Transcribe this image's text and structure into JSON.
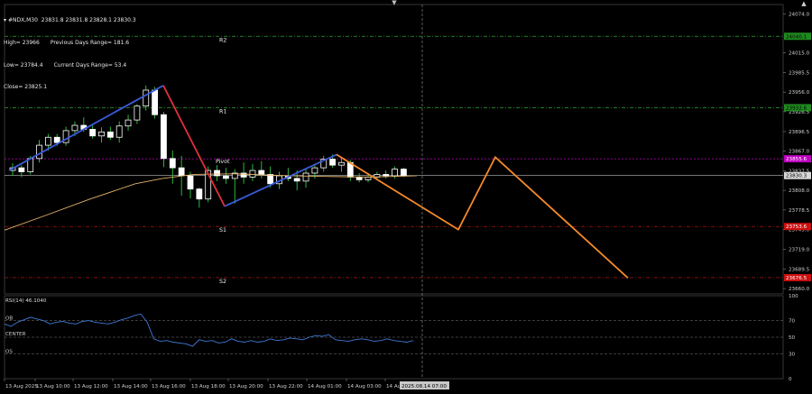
{
  "header": {
    "symbol": "#NDX,M30",
    "ohlc": "23831.8 23831.8 23828.1 23830.3",
    "high": "High= 23966",
    "low": "Low= 23784.4",
    "close": "Close= 23825.1",
    "prev_range": "Previous Days Range= 181.6",
    "curr_range": "Current Days Range= 53.4",
    "collapse_icon": "triangle-down-icon"
  },
  "pivot_labels": {
    "r2": "R2",
    "r1": "R1",
    "pivot": "Pivot",
    "s1": "S1",
    "s2": "S2"
  },
  "price_axis": {
    "ticks": [
      "24074.0",
      "24015.0",
      "23985.5",
      "23956.0",
      "23926.5",
      "23896.5",
      "23867.0",
      "23837.5",
      "23808.0",
      "23778.5",
      "23749.0",
      "23719.0",
      "23689.5",
      "23660.0"
    ],
    "level_tags": [
      {
        "text": "24040.1",
        "color": "#1f8a1f",
        "fg": "#000000"
      },
      {
        "text": "23932.6",
        "color": "#1f8a1f",
        "fg": "#000000"
      },
      {
        "text": "23855.6",
        "color": "#c000c0",
        "fg": "#ffffff"
      },
      {
        "text": "23830.3",
        "color": "#d8d8d8",
        "fg": "#000000"
      },
      {
        "text": "23753.6",
        "color": "#cc1010",
        "fg": "#ffffff"
      },
      {
        "text": "23676.5",
        "color": "#cc1010",
        "fg": "#ffffff"
      }
    ]
  },
  "rsi": {
    "label": "RSI(14) 46.1040",
    "ob": "OB",
    "center": "CENTER",
    "os": "OS",
    "ticks": [
      "100",
      "70",
      "50",
      "30",
      "0"
    ],
    "values": [
      66,
      63,
      68,
      71,
      74,
      72,
      70,
      66,
      68,
      69,
      67,
      66,
      69,
      70,
      68,
      67,
      66,
      68,
      71,
      73,
      76,
      78,
      68,
      48,
      45,
      46,
      44,
      43,
      42,
      39,
      47,
      45,
      46,
      43,
      44,
      48,
      45,
      44,
      46,
      44,
      45,
      48,
      46,
      47,
      49,
      48,
      47,
      50,
      52,
      51,
      53,
      47,
      46,
      45,
      47,
      48,
      47,
      45,
      46,
      48,
      46,
      45,
      44,
      46
    ]
  },
  "time_axis": {
    "labels": [
      "13 Aug 2025",
      "13 Aug 10:00",
      "13 Aug 12:00",
      "13 Aug 14:00",
      "13 Aug 16:00",
      "13 Aug 18:00",
      "13 Aug 20:00",
      "13 Aug 22:00",
      "14 Aug 01:00",
      "14 Aug 03:00",
      "14 Au"
    ],
    "cursor_label": "2025.08.14 07:00"
  },
  "colors": {
    "background": "#000000",
    "bull": "#ffffff",
    "bear": "#ffffff",
    "wick": "#2ecc40",
    "ma": "#e3b36a",
    "zigzag_up": "#3a5bd9",
    "zigzag_down": "#e0303a",
    "projection": "#f58a2a",
    "resistance": "#2ea62e",
    "support": "#cc1a1a",
    "pivot": "#c000c0",
    "rsi_line": "#3f79d6",
    "axis_text": "#cfcfcf"
  },
  "chart_data": {
    "type": "candlestick",
    "symbol": "#NDX",
    "timeframe": "M30",
    "levels": {
      "R2": 24040.1,
      "R1": 23932.6,
      "Pivot": 23855.6,
      "S1": 23753.6,
      "S2": 23676.5,
      "current": 23830.3
    },
    "candles": [
      [
        23838,
        23849,
        23830,
        23842
      ],
      [
        23842,
        23846,
        23828,
        23836
      ],
      [
        23836,
        23860,
        23832,
        23856
      ],
      [
        23856,
        23884,
        23850,
        23876
      ],
      [
        23876,
        23893,
        23868,
        23888
      ],
      [
        23888,
        23893,
        23875,
        23880
      ],
      [
        23880,
        23904,
        23875,
        23898
      ],
      [
        23898,
        23912,
        23890,
        23906
      ],
      [
        23906,
        23918,
        23896,
        23900
      ],
      [
        23900,
        23906,
        23886,
        23890
      ],
      [
        23890,
        23903,
        23880,
        23896
      ],
      [
        23896,
        23904,
        23884,
        23888
      ],
      [
        23888,
        23912,
        23880,
        23905
      ],
      [
        23905,
        23922,
        23898,
        23914
      ],
      [
        23914,
        23938,
        23908,
        23935
      ],
      [
        23935,
        23966,
        23928,
        23959
      ],
      [
        23959,
        23964,
        23916,
        23922
      ],
      [
        23922,
        23926,
        23843,
        23856
      ],
      [
        23856,
        23868,
        23818,
        23842
      ],
      [
        23842,
        23860,
        23800,
        23830
      ],
      [
        23830,
        23836,
        23796,
        23810
      ],
      [
        23810,
        23812,
        23782,
        23795
      ],
      [
        23795,
        23844,
        23790,
        23838
      ],
      [
        23838,
        23846,
        23822,
        23830
      ],
      [
        23830,
        23842,
        23818,
        23826
      ],
      [
        23826,
        23840,
        23788,
        23834
      ],
      [
        23834,
        23850,
        23818,
        23828
      ],
      [
        23828,
        23848,
        23822,
        23838
      ],
      [
        23838,
        23852,
        23826,
        23832
      ],
      [
        23832,
        23844,
        23812,
        23818
      ],
      [
        23818,
        23836,
        23810,
        23830
      ],
      [
        23830,
        23842,
        23822,
        23826
      ],
      [
        23826,
        23838,
        23808,
        23822
      ],
      [
        23822,
        23840,
        23812,
        23834
      ],
      [
        23834,
        23848,
        23826,
        23842
      ],
      [
        23842,
        23860,
        23836,
        23855
      ],
      [
        23855,
        23862,
        23842,
        23846
      ],
      [
        23846,
        23856,
        23836,
        23850
      ],
      [
        23850,
        23854,
        23822,
        23828
      ],
      [
        23828,
        23834,
        23820,
        23824
      ],
      [
        23824,
        23832,
        23820,
        23828
      ],
      [
        23828,
        23836,
        23824,
        23832
      ],
      [
        23832,
        23838,
        23826,
        23830
      ],
      [
        23830,
        23844,
        23826,
        23840
      ],
      [
        23840,
        23842,
        23828,
        23830
      ]
    ],
    "projection": [
      [
        23830,
        0
      ],
      [
        23749,
        1
      ],
      [
        23858,
        2
      ],
      [
        23676,
        3
      ]
    ]
  }
}
